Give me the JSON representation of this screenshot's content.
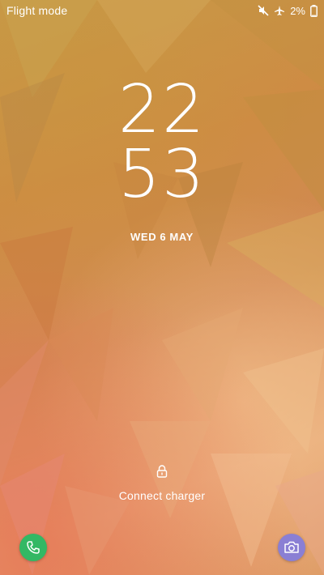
{
  "statusbar": {
    "mode_label": "Flight mode",
    "battery_percent": "2%",
    "icons": [
      "mute-icon",
      "airplane-icon",
      "battery-icon"
    ]
  },
  "clock": {
    "hour": "22",
    "minute": "53"
  },
  "date": "WED 6 MAY",
  "lock_prompt": "Connect charger",
  "shortcuts": {
    "phone": {
      "icon": "phone-icon",
      "color": "#33b864"
    },
    "camera": {
      "icon": "camera-icon",
      "color": "#8a7fd4"
    }
  },
  "colors": {
    "wallpaper_base": "#d28a54",
    "text": "#ffffff"
  }
}
